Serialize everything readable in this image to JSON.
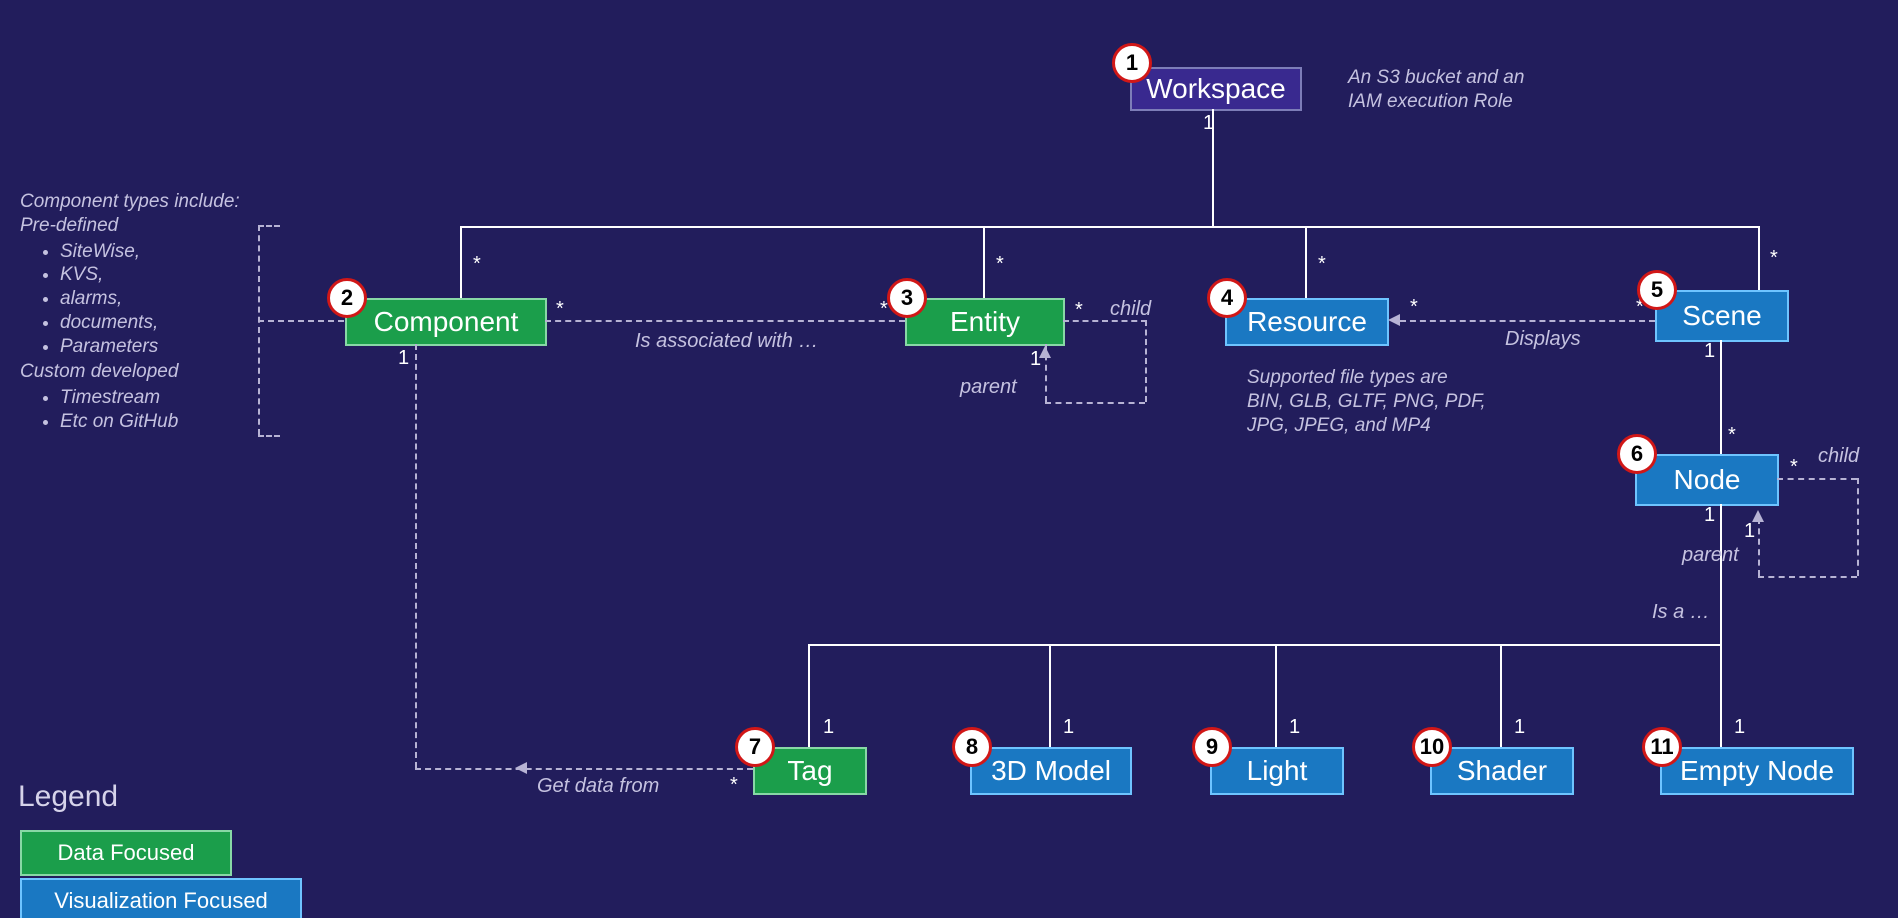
{
  "nodes": {
    "workspace": {
      "label": "Workspace",
      "num": "1"
    },
    "component": {
      "label": "Component",
      "num": "2"
    },
    "entity": {
      "label": "Entity",
      "num": "3"
    },
    "resource": {
      "label": "Resource",
      "num": "4"
    },
    "scene": {
      "label": "Scene",
      "num": "5"
    },
    "node": {
      "label": "Node",
      "num": "6"
    },
    "tag": {
      "label": "Tag",
      "num": "7"
    },
    "model3d": {
      "label": "3D Model",
      "num": "8"
    },
    "light": {
      "label": "Light",
      "num": "9"
    },
    "shader": {
      "label": "Shader",
      "num": "10"
    },
    "emptynode": {
      "label": "Empty Node",
      "num": "11"
    }
  },
  "annotations": {
    "workspace_note_line1": "An S3 bucket and an",
    "workspace_note_line2": "IAM execution Role",
    "resource_note_line1": "Supported file types are",
    "resource_note_line2": "BIN, GLB, GLTF, PNG, PDF,",
    "resource_note_line3": "JPG, JPEG, and MP4",
    "component_note_heading": "Component types include:",
    "component_note_pre": "Pre-defined",
    "component_note_items_pre": [
      "SiteWise,",
      "KVS,",
      "alarms,",
      "documents,",
      "Parameters"
    ],
    "component_note_custom": "Custom developed",
    "component_note_items_custom": [
      "Timestream",
      "Etc on GitHub"
    ]
  },
  "edge_labels": {
    "is_associated_with": "Is associated with …",
    "child": "child",
    "parent": "parent",
    "displays": "Displays",
    "is_a": "Is a …",
    "get_data_from": "Get data from"
  },
  "cardinality": {
    "one": "1",
    "many": "*"
  },
  "legend": {
    "title": "Legend",
    "data_focused": "Data Focused",
    "viz_focused": "Visualization Focused"
  }
}
